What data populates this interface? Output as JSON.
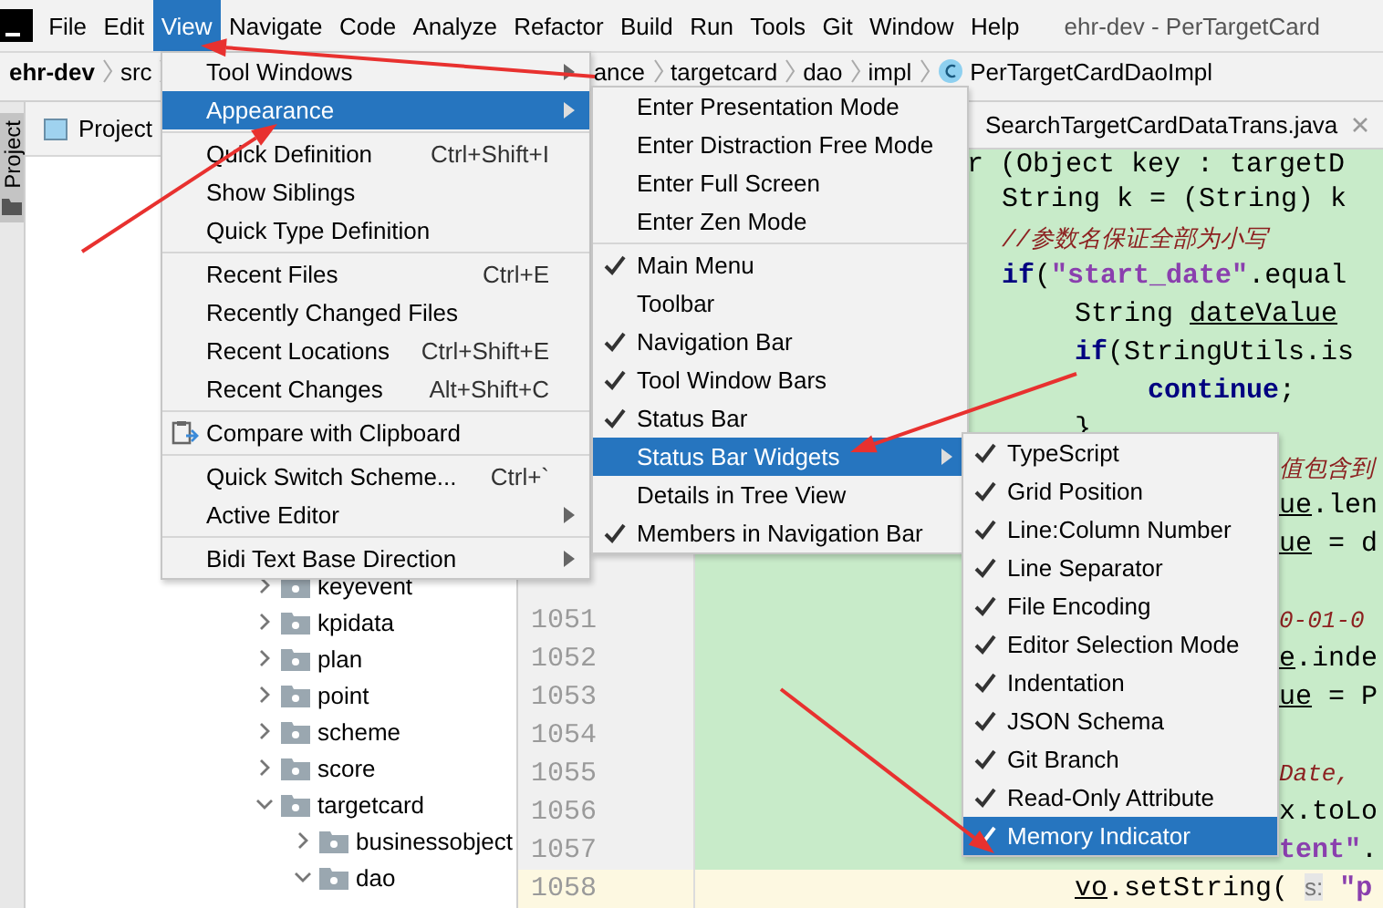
{
  "menu_bar": {
    "items": [
      {
        "label": "File",
        "selected": false
      },
      {
        "label": "Edit",
        "selected": false
      },
      {
        "label": "View",
        "selected": true
      },
      {
        "label": "Navigate",
        "selected": false
      },
      {
        "label": "Code",
        "selected": false
      },
      {
        "label": "Analyze",
        "selected": false
      },
      {
        "label": "Refactor",
        "selected": false
      },
      {
        "label": "Build",
        "selected": false
      },
      {
        "label": "Run",
        "selected": false
      },
      {
        "label": "Tools",
        "selected": false
      },
      {
        "label": "Git",
        "selected": false
      },
      {
        "label": "Window",
        "selected": false
      },
      {
        "label": "Help",
        "selected": false
      }
    ],
    "title": "ehr-dev - PerTargetCard"
  },
  "nav_bar": {
    "left": [
      "ehr-dev",
      "src"
    ],
    "right": [
      "ance",
      "targetcard",
      "dao",
      "impl"
    ],
    "file": "PerTargetCardDaoImpl"
  },
  "tool_strip": {
    "label": "Project",
    "selected": true
  },
  "project_panel": {
    "title": "Project",
    "tree": [
      {
        "label": "keyevent",
        "expanded": false
      },
      {
        "label": "kpidata",
        "expanded": false
      },
      {
        "label": "plan",
        "expanded": false
      },
      {
        "label": "point",
        "expanded": false
      },
      {
        "label": "scheme",
        "expanded": false
      },
      {
        "label": "score",
        "expanded": false
      },
      {
        "label": "targetcard",
        "expanded": true,
        "children": [
          {
            "label": "businessobject",
            "expanded": false
          },
          {
            "label": "dao",
            "expanded": true
          }
        ]
      }
    ]
  },
  "editor": {
    "tab": "SearchTargetCardDataTrans.java",
    "lines": [
      {
        "current": false,
        "segments": [
          {
            "kind": "plain",
            "text": "r (Object key : targetD"
          }
        ]
      },
      {
        "current": false,
        "segments": [
          {
            "kind": "plain",
            "text": "String k = (String) k"
          }
        ]
      },
      {
        "current": false,
        "segments": [
          {
            "kind": "comment",
            "text": "//参数名保证全部为小写"
          }
        ]
      },
      {
        "current": false,
        "segments": [
          {
            "kind": "keyword",
            "text": "if"
          },
          {
            "kind": "plain",
            "text": "("
          },
          {
            "kind": "string",
            "text": "\"start_date\""
          },
          {
            "kind": "plain",
            "text": ".equal"
          }
        ]
      },
      {
        "current": false,
        "segments": [
          {
            "kind": "plain",
            "text": "String "
          },
          {
            "kind": "underlined",
            "text": "dateValue"
          }
        ]
      },
      {
        "current": false,
        "segments": [
          {
            "kind": "keyword",
            "text": "if"
          },
          {
            "kind": "plain",
            "text": "(StringUtils.is"
          }
        ]
      },
      {
        "current": false,
        "segments": [
          {
            "kind": "keyword",
            "text": "continue"
          },
          {
            "kind": "plain",
            "text": ";"
          }
        ]
      },
      {
        "current": false,
        "segments": [
          {
            "kind": "plain",
            "text": "}"
          }
        ]
      },
      {
        "current": false,
        "segments": [
          {
            "kind": "comment",
            "text": "值包含到"
          }
        ]
      },
      {
        "current": false,
        "segments": [
          {
            "kind": "underlined",
            "text": "ue"
          },
          {
            "kind": "plain",
            "text": ".len"
          }
        ]
      },
      {
        "current": false,
        "segments": [
          {
            "kind": "underlined",
            "text": "ue"
          },
          {
            "kind": "plain",
            "text": " = d"
          }
        ]
      },
      {
        "current": false
      },
      {
        "number": "1051",
        "current": false,
        "segments": [
          {
            "kind": "comment",
            "text": "0-01-0"
          }
        ]
      },
      {
        "number": "1052",
        "current": false,
        "segments": [
          {
            "kind": "underlined",
            "text": "e"
          },
          {
            "kind": "plain",
            "text": ".inde"
          }
        ]
      },
      {
        "number": "1053",
        "current": false,
        "segments": [
          {
            "kind": "underlined",
            "text": "ue"
          },
          {
            "kind": "plain",
            "text": " = P"
          }
        ]
      },
      {
        "number": "1054",
        "current": false
      },
      {
        "number": "1055",
        "current": false,
        "segments": [
          {
            "kind": "comment",
            "text": "Date,"
          }
        ]
      },
      {
        "number": "1056",
        "current": false,
        "segments": [
          {
            "kind": "plain",
            "text": "x.toLo"
          }
        ]
      },
      {
        "number": "1057",
        "current": false,
        "segments": [
          {
            "kind": "string",
            "text": "tent\""
          },
          {
            "kind": "plain",
            "text": "."
          }
        ]
      },
      {
        "number": "1058",
        "current": true,
        "segments": [
          {
            "kind": "underlined",
            "text": "vo"
          },
          {
            "kind": "plain",
            "text": ".setString( "
          },
          {
            "kind": "hint",
            "text": "s:"
          },
          {
            "kind": "string",
            "text": " \"p"
          }
        ]
      }
    ]
  },
  "menus": [
    {
      "items": [
        {
          "kind": "item",
          "label": "Tool Windows",
          "submenu": true,
          "selected": false
        },
        {
          "kind": "item",
          "label": "Appearance",
          "submenu": true,
          "selected": true
        },
        {
          "kind": "separator"
        },
        {
          "kind": "item",
          "label": "Quick Definition",
          "shortcut": "Ctrl+Shift+I",
          "selected": false
        },
        {
          "kind": "item",
          "label": "Show Siblings",
          "selected": false
        },
        {
          "kind": "item",
          "label": "Quick Type Definition",
          "selected": false
        },
        {
          "kind": "separator"
        },
        {
          "kind": "item",
          "label": "Recent Files",
          "shortcut": "Ctrl+E",
          "selected": false
        },
        {
          "kind": "item",
          "label": "Recently Changed Files",
          "selected": false
        },
        {
          "kind": "item",
          "label": "Recent Locations",
          "shortcut": "Ctrl+Shift+E",
          "selected": false
        },
        {
          "kind": "item",
          "label": "Recent Changes",
          "shortcut": "Alt+Shift+C",
          "selected": false
        },
        {
          "kind": "separator"
        },
        {
          "kind": "item",
          "label": "Compare with Clipboard",
          "has_icon": true,
          "selected": false
        },
        {
          "kind": "separator"
        },
        {
          "kind": "item",
          "label": "Quick Switch Scheme...",
          "shortcut": "Ctrl+`",
          "selected": false
        },
        {
          "kind": "item",
          "label": "Active Editor",
          "submenu": true,
          "selected": false
        },
        {
          "kind": "separator"
        },
        {
          "kind": "item",
          "label": "Bidi Text Base Direction",
          "submenu": true,
          "selected": false
        }
      ]
    },
    {
      "items": [
        {
          "kind": "item",
          "label": "Enter Presentation Mode",
          "checked": false,
          "selected": false
        },
        {
          "kind": "item",
          "label": "Enter Distraction Free Mode",
          "checked": false,
          "selected": false
        },
        {
          "kind": "item",
          "label": "Enter Full Screen",
          "checked": false,
          "selected": false
        },
        {
          "kind": "item",
          "label": "Enter Zen Mode",
          "checked": false,
          "selected": false
        },
        {
          "kind": "separator"
        },
        {
          "kind": "item",
          "label": "Main Menu",
          "checked": true,
          "selected": false
        },
        {
          "kind": "item",
          "label": "Toolbar",
          "checked": false,
          "selected": false
        },
        {
          "kind": "item",
          "label": "Navigation Bar",
          "checked": true,
          "selected": false
        },
        {
          "kind": "item",
          "label": "Tool Window Bars",
          "checked": true,
          "selected": false
        },
        {
          "kind": "item",
          "label": "Status Bar",
          "checked": true,
          "selected": false
        },
        {
          "kind": "item",
          "label": "Status Bar Widgets",
          "submenu": true,
          "checked": false,
          "selected": true
        },
        {
          "kind": "item",
          "label": "Details in Tree View",
          "checked": false,
          "selected": false
        },
        {
          "kind": "item",
          "label": "Members in Navigation Bar",
          "checked": true,
          "selected": false
        }
      ]
    },
    {
      "items": [
        {
          "kind": "item",
          "label": "TypeScript",
          "checked": true,
          "selected": false
        },
        {
          "kind": "item",
          "label": "Grid Position",
          "checked": true,
          "selected": false
        },
        {
          "kind": "item",
          "label": "Line:Column Number",
          "checked": true,
          "selected": false
        },
        {
          "kind": "item",
          "label": "Line Separator",
          "checked": true,
          "selected": false
        },
        {
          "kind": "item",
          "label": "File Encoding",
          "checked": true,
          "selected": false
        },
        {
          "kind": "item",
          "label": "Editor Selection Mode",
          "checked": true,
          "selected": false
        },
        {
          "kind": "item",
          "label": "Indentation",
          "checked": true,
          "selected": false
        },
        {
          "kind": "item",
          "label": "JSON Schema",
          "checked": true,
          "selected": false
        },
        {
          "kind": "item",
          "label": "Git Branch",
          "checked": true,
          "selected": false
        },
        {
          "kind": "item",
          "label": "Read-Only Attribute",
          "checked": true,
          "selected": false
        },
        {
          "kind": "item",
          "label": "Memory Indicator",
          "checked": true,
          "selected": true
        }
      ]
    }
  ]
}
